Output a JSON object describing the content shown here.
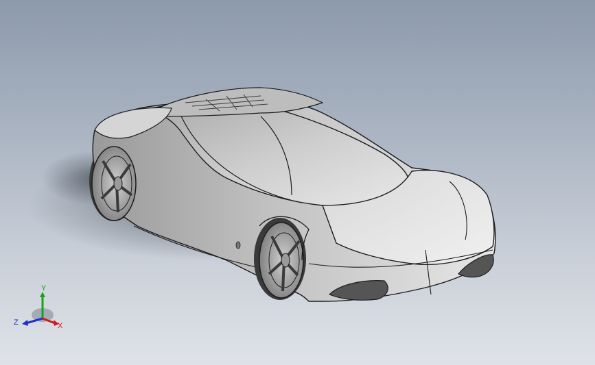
{
  "viewport": {
    "background_top": "#8d9aac",
    "background_bottom": "#dfe3e8"
  },
  "model": {
    "body_color": "#c4c4c4",
    "edge_color": "#1c1c1c"
  },
  "triad": {
    "axes": [
      {
        "name": "y",
        "label": "Y",
        "color": "#1aa11a"
      },
      {
        "name": "z",
        "label": "Z",
        "color": "#1f2fd0"
      },
      {
        "name": "x",
        "label": "X",
        "color": "#d11a1a"
      }
    ]
  }
}
